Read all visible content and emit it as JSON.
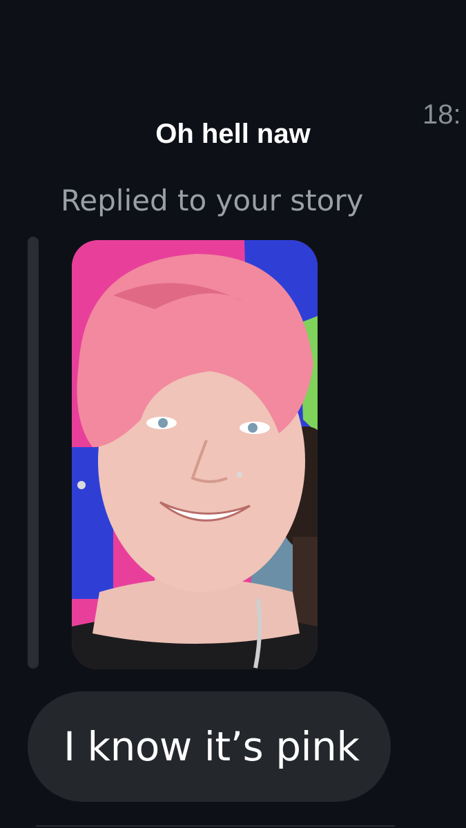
{
  "message": {
    "timestamp": "18:",
    "story_caption": "Oh hell naw",
    "reply_label": "Replied to your story",
    "story_thumbnail": {
      "description_icon": "person-photo-icon",
      "colors": {
        "background_pink": "#e8409a",
        "background_blue": "#2f3fd6",
        "background_green": "#7fd35a",
        "hair": "#f2899f",
        "skin": "#f0c4b8",
        "shirt": "#1c1c1e"
      }
    },
    "bubble_text": "I know it’s pink"
  },
  "theme": {
    "background": "#0d1117",
    "bubble": "#24272c",
    "muted_text": "#9aa0a6"
  }
}
